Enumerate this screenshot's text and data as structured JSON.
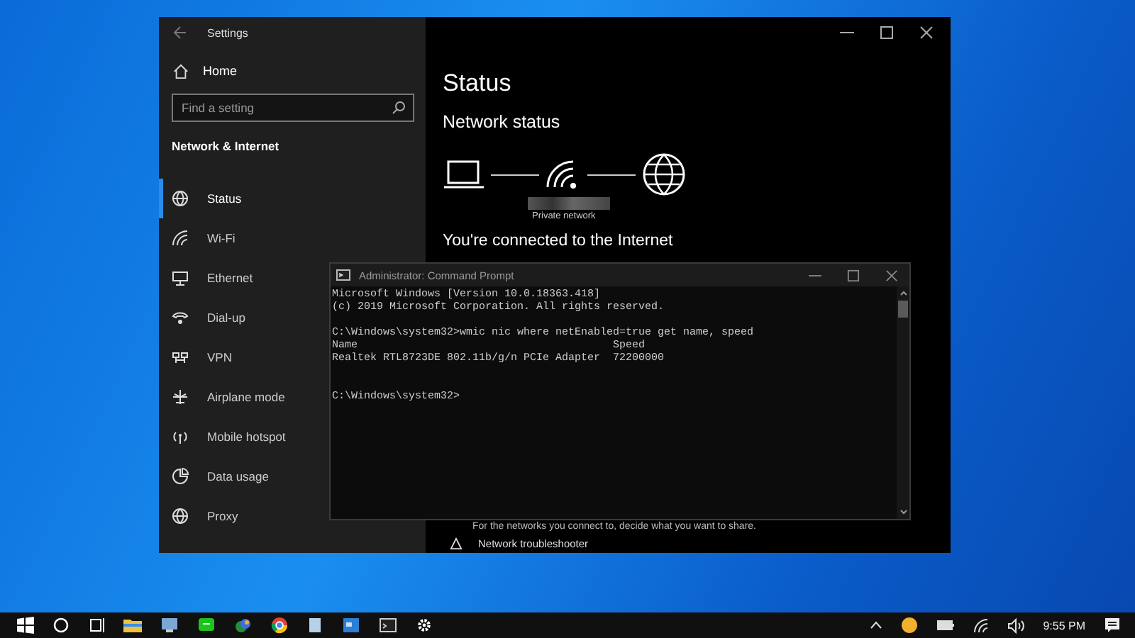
{
  "settings_window": {
    "title": "Settings",
    "home": "Home",
    "search": {
      "placeholder": "Find a setting"
    },
    "section": "Network & Internet",
    "nav": [
      {
        "label": "Status",
        "selected": true
      },
      {
        "label": "Wi-Fi",
        "selected": false
      },
      {
        "label": "Ethernet",
        "selected": false
      },
      {
        "label": "Dial-up",
        "selected": false
      },
      {
        "label": "VPN",
        "selected": false
      },
      {
        "label": "Airplane mode",
        "selected": false
      },
      {
        "label": "Mobile hotspot",
        "selected": false
      },
      {
        "label": "Data usage",
        "selected": false
      },
      {
        "label": "Proxy",
        "selected": false
      }
    ],
    "page_title": "Status",
    "heading": "Network status",
    "network_label": "Private network",
    "connection_text": "You're connected to the Internet",
    "sharing_text": "For the networks you connect to, decide what you want to share.",
    "troubleshooter": "Network troubleshooter"
  },
  "cmd_window": {
    "title": "Administrator: Command Prompt",
    "blocks": [
      [
        "Microsoft Windows [Version 10.0.18363.418]",
        "(c) 2019 Microsoft Corporation. All rights reserved."
      ],
      [
        "C:\\Windows\\system32>wmic nic where netEnabled=true get name, speed",
        "Name                                        Speed",
        "Realtek RTL8723DE 802.11b/g/n PCIe Adapter  72200000"
      ],
      [
        "C:\\Windows\\system32>"
      ]
    ]
  },
  "taskbar": {
    "clock": "9:55 PM"
  }
}
